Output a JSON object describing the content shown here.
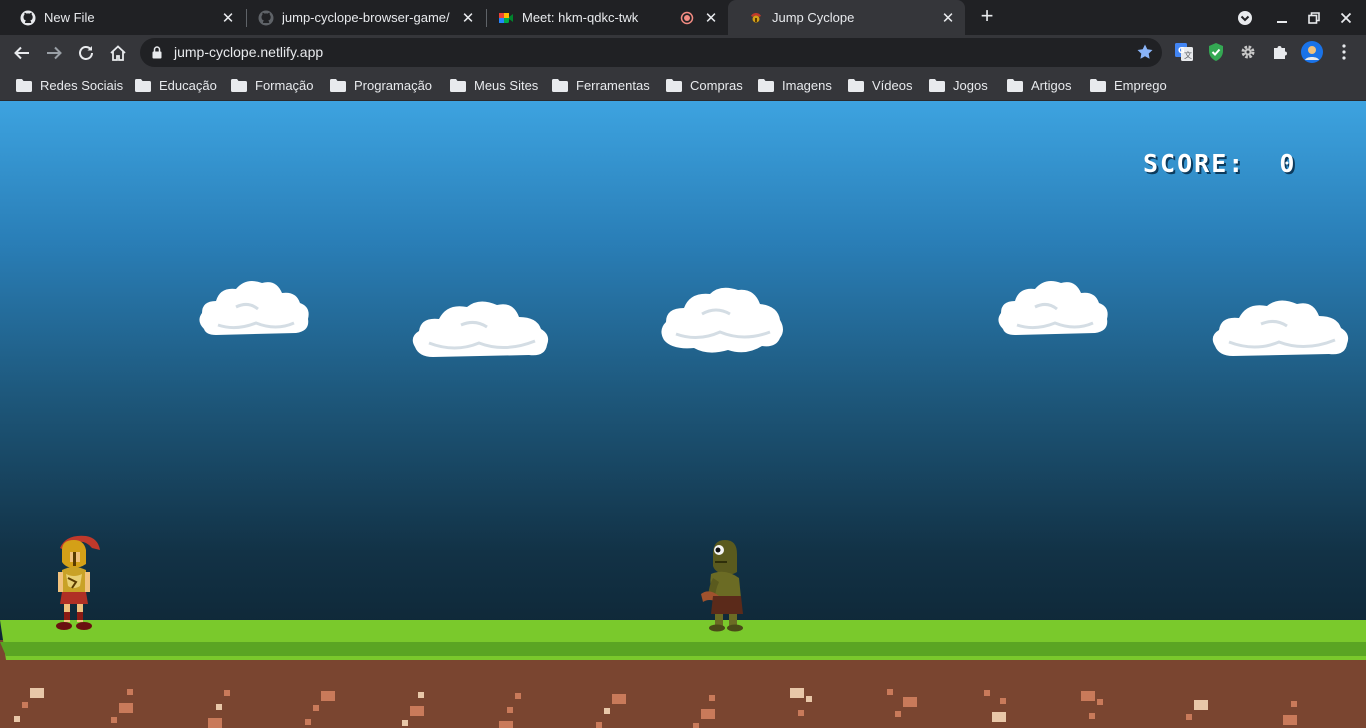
{
  "browser": {
    "tabs": [
      {
        "title": "New File",
        "icon": "github-icon",
        "active": false
      },
      {
        "title": "jump-cyclope-browser-game/",
        "icon": "github-icon",
        "active": false
      },
      {
        "title": "Meet: hkm-qdkc-twk",
        "icon": "google-meet-icon",
        "active": false,
        "recording": true
      },
      {
        "title": "Jump Cyclope",
        "icon": "spartan-helmet-icon",
        "active": true
      }
    ],
    "url": "jump-cyclope.netlify.app",
    "bookmarks": [
      "Redes Sociais",
      "Educação",
      "Formação",
      "Programação",
      "Meus Sites",
      "Ferramentas",
      "Compras",
      "Imagens",
      "Vídeos",
      "Jogos",
      "Artigos",
      "Emprego"
    ]
  },
  "game": {
    "score_label": "SCORE:",
    "score_value": "0",
    "player": "spartan-warrior-sprite",
    "enemy": "cyclops-sprite",
    "colors": {
      "sky_top": "#3da3e0",
      "sky_bottom": "#0b1b25",
      "grass": "#7ac92c",
      "dirt": "#7a4530"
    }
  }
}
